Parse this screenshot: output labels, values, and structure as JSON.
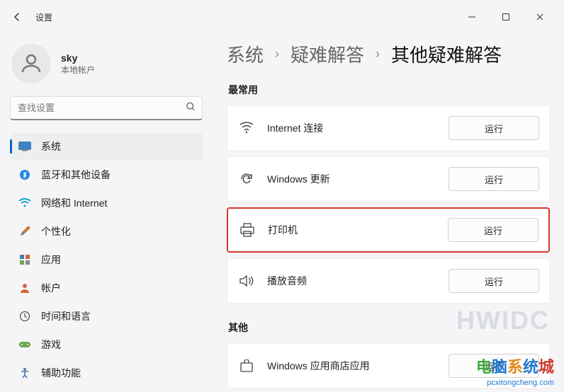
{
  "window": {
    "title": "设置"
  },
  "user": {
    "name": "sky",
    "subtitle": "本地帐户"
  },
  "search": {
    "placeholder": "查找设置"
  },
  "nav": {
    "items": [
      {
        "label": "系统"
      },
      {
        "label": "蓝牙和其他设备"
      },
      {
        "label": "网络和 Internet"
      },
      {
        "label": "个性化"
      },
      {
        "label": "应用"
      },
      {
        "label": "帐户"
      },
      {
        "label": "时间和语言"
      },
      {
        "label": "游戏"
      },
      {
        "label": "辅助功能"
      }
    ]
  },
  "breadcrumb": {
    "a": "系统",
    "b": "疑难解答",
    "c": "其他疑难解答"
  },
  "sections": {
    "frequent": "最常用",
    "other": "其他"
  },
  "troubleshooters": {
    "frequent": [
      {
        "label": "Internet 连接",
        "button": "运行"
      },
      {
        "label": "Windows 更新",
        "button": "运行"
      },
      {
        "label": "打印机",
        "button": "运行"
      },
      {
        "label": "播放音频",
        "button": "运行"
      }
    ],
    "other": [
      {
        "label": "Windows 应用商店应用",
        "button": "运行"
      }
    ]
  },
  "watermark": {
    "big": "HWIDC",
    "brand": "电脑系统城",
    "url": "pcxitongcheng.com"
  }
}
